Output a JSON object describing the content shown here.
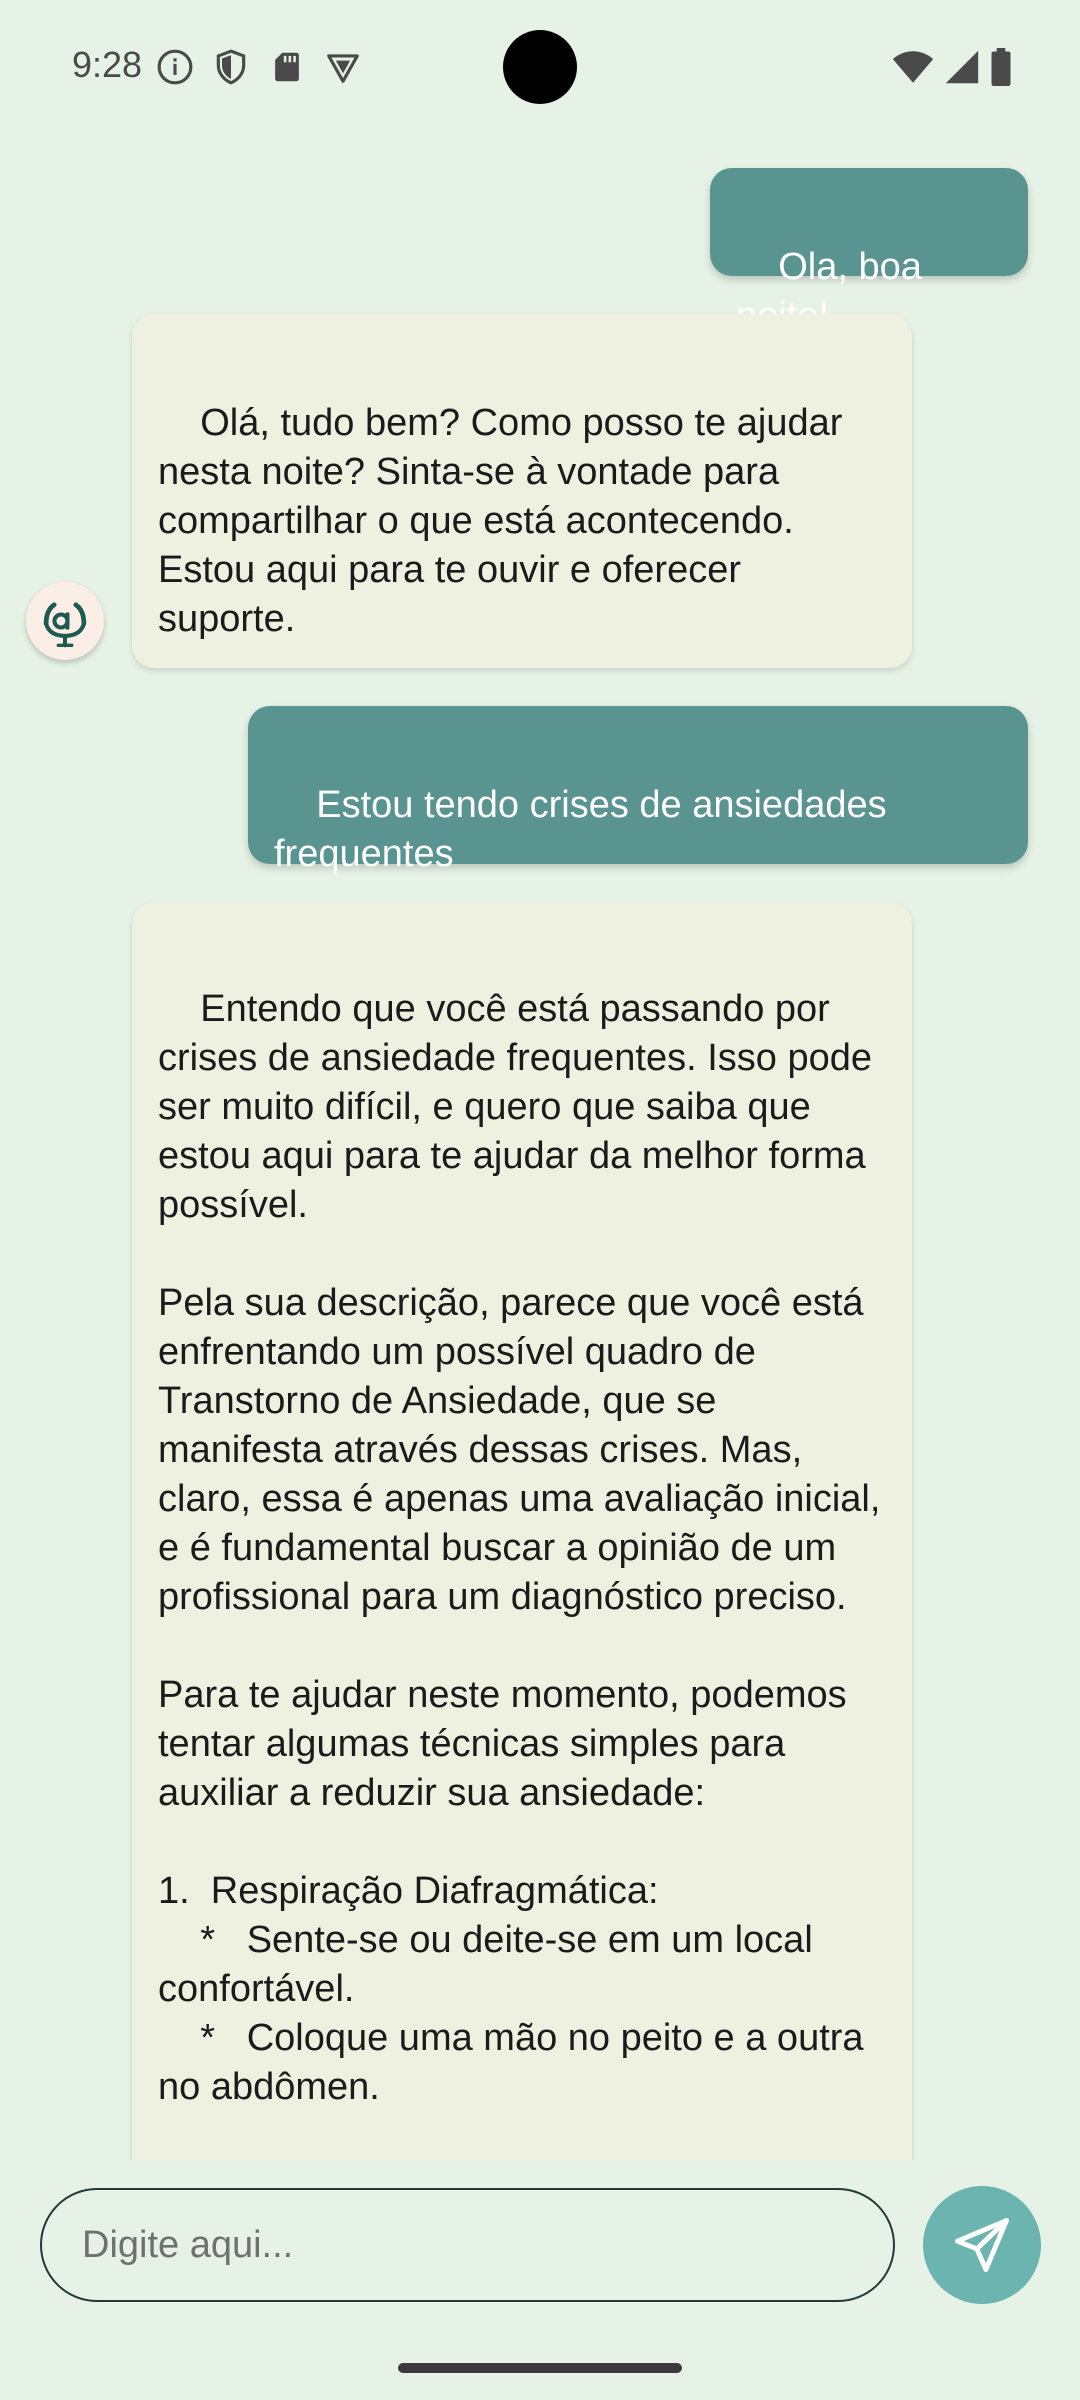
{
  "status_bar": {
    "time": "9:28"
  },
  "messages": [
    {
      "role": "user",
      "text": "Ola, boa noite!"
    },
    {
      "role": "bot",
      "text": "Olá, tudo bem? Como posso te ajudar nesta noite? Sinta-se à vontade para compartilhar o que está acontecendo. Estou aqui para te ouvir e oferecer suporte."
    },
    {
      "role": "user",
      "text": "Estou tendo crises de ansiedades frequentes"
    },
    {
      "role": "bot",
      "text": "Entendo que você está passando por crises de ansiedade frequentes. Isso pode ser muito difícil, e quero que saiba que estou aqui para te ajudar da melhor forma possível.\n\nPela sua descrição, parece que você está enfrentando um possível quadro de Transtorno de Ansiedade, que se manifesta através dessas crises. Mas, claro, essa é apenas uma avaliação inicial, e é fundamental buscar a opinião de um profissional para um diagnóstico preciso.\n\nPara te ajudar neste momento, podemos tentar algumas técnicas simples para auxiliar a reduzir sua ansiedade:\n\n1.  Respiração Diafragmática:\n    *   Sente-se ou deite-se em um local confortável.\n    *   Coloque uma mão no peito e a outra no abdômen."
    }
  ],
  "input": {
    "placeholder": "Digite aqui..."
  },
  "icons": {
    "avatar": "lai-logo",
    "send": "paper-plane-icon"
  },
  "colors": {
    "background": "#e6f2e6",
    "user_bubble": "#5a9490",
    "bot_bubble": "#eef0e0",
    "send_button": "#6bb4b0"
  }
}
